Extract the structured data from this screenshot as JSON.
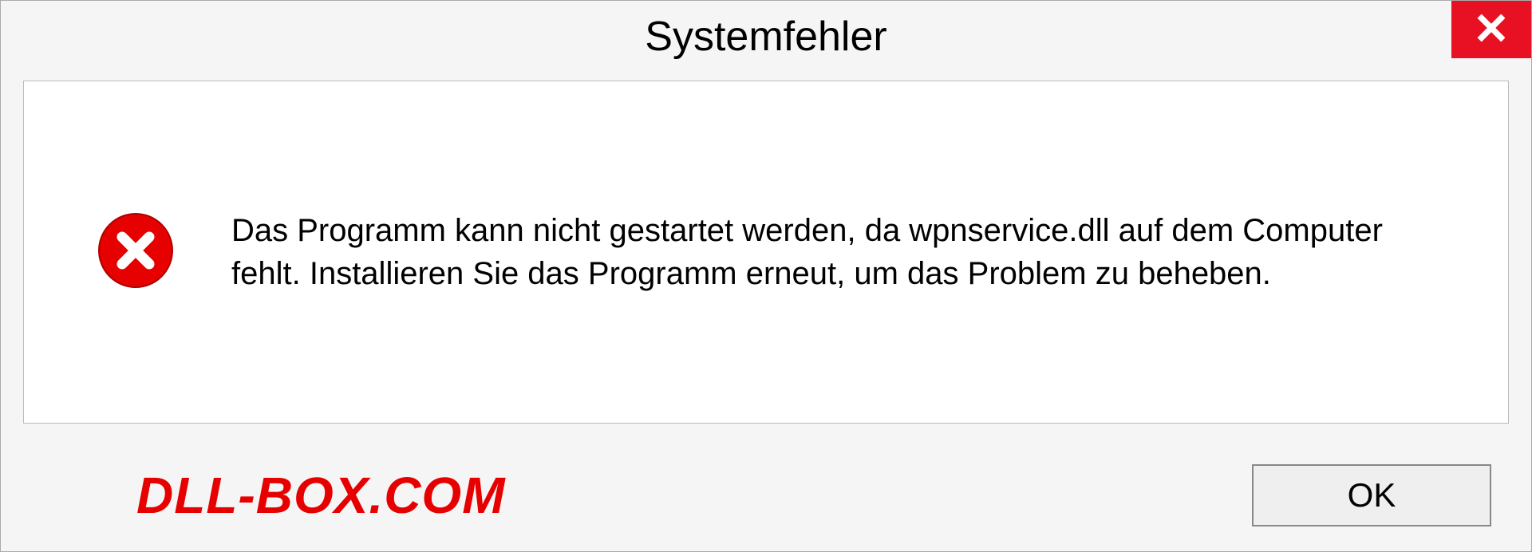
{
  "dialog": {
    "title": "Systemfehler",
    "message": "Das Programm kann nicht gestartet werden, da wpnservice.dll auf dem Computer fehlt. Installieren Sie das Programm erneut, um das Problem zu beheben.",
    "ok_label": "OK"
  },
  "watermark": "DLL-BOX.COM",
  "colors": {
    "close_btn": "#e81123",
    "error_icon": "#e60000",
    "watermark": "#e60000"
  }
}
